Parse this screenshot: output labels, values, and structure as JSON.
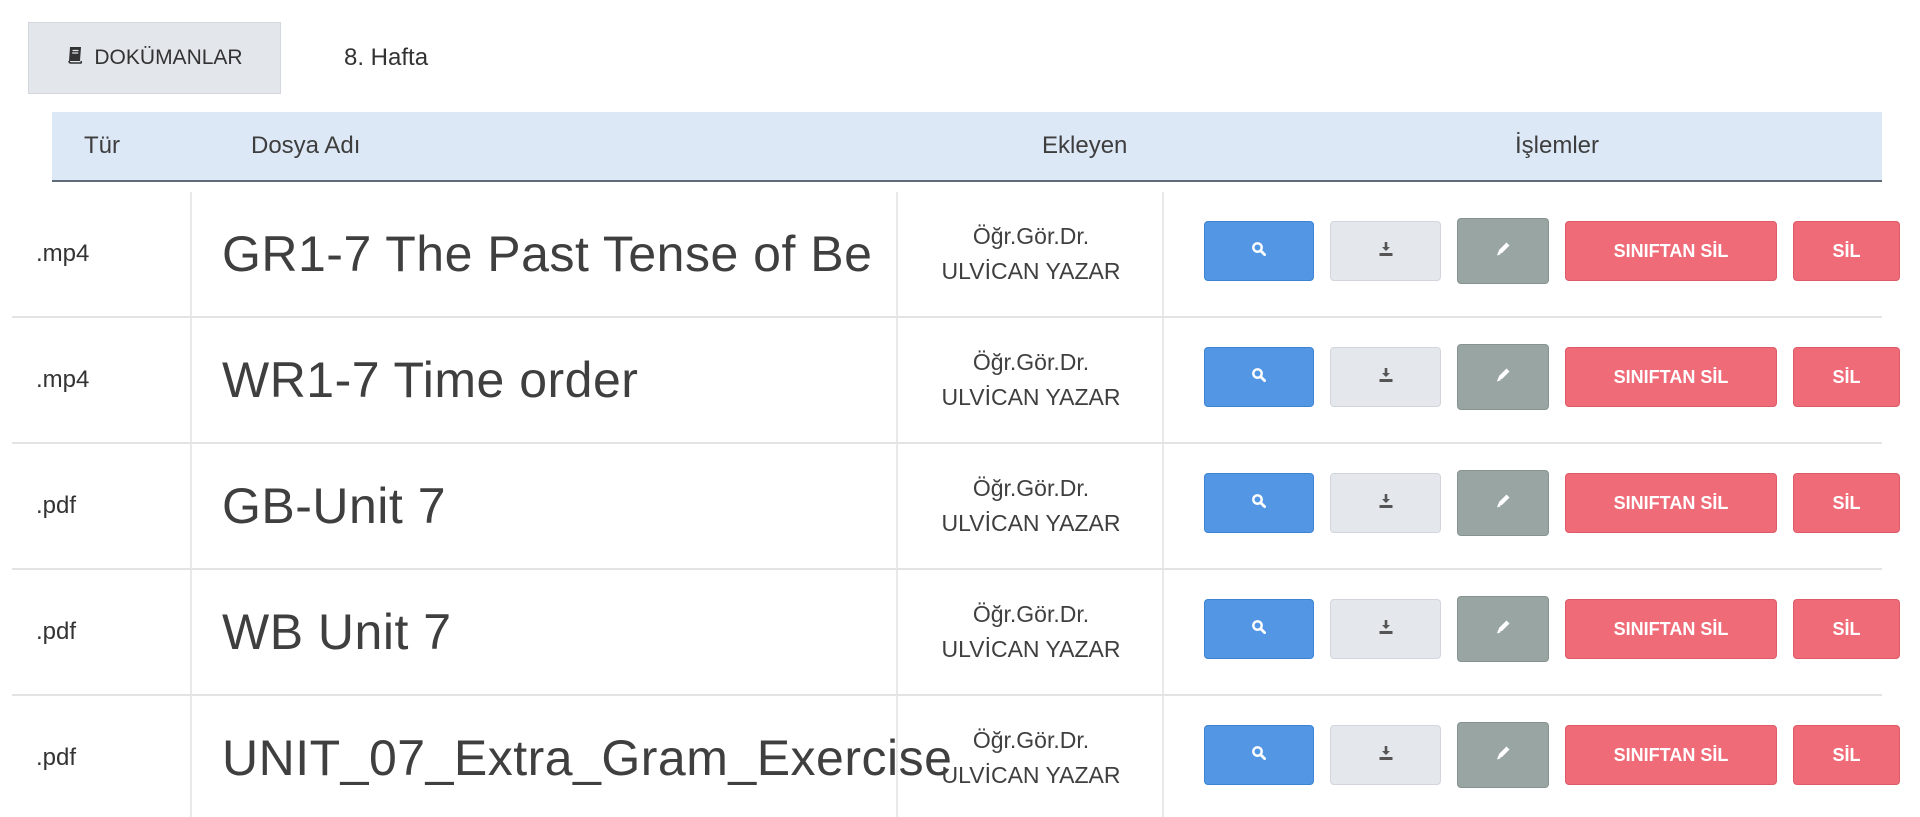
{
  "tab": {
    "label": "DOKÜMANLAR",
    "icon": "book-icon"
  },
  "week_label": "8. Hafta",
  "table": {
    "headers": {
      "type": "Tür",
      "name": "Dosya Adı",
      "added_by": "Ekleyen",
      "actions": "İşlemler"
    },
    "rows": [
      {
        "type": ".mp4",
        "name": "GR1-7 The Past Tense of Be",
        "added_by_title": "Öğr.Gör.Dr.",
        "added_by_name": "ULVİCAN YAZAR"
      },
      {
        "type": ".mp4",
        "name": "WR1-7 Time order",
        "added_by_title": "Öğr.Gör.Dr.",
        "added_by_name": "ULVİCAN YAZAR"
      },
      {
        "type": ".pdf",
        "name": "GB-Unit 7",
        "added_by_title": "Öğr.Gör.Dr.",
        "added_by_name": "ULVİCAN YAZAR"
      },
      {
        "type": ".pdf",
        "name": "WB Unit 7",
        "added_by_title": "Öğr.Gör.Dr.",
        "added_by_name": "ULVİCAN YAZAR"
      },
      {
        "type": ".pdf",
        "name": "UNIT_07_Extra_Gram_Exercise",
        "added_by_title": "Öğr.Gör.Dr.",
        "added_by_name": "ULVİCAN YAZAR"
      }
    ]
  },
  "actions": {
    "view_icon": "search-icon",
    "download_icon": "download-icon",
    "edit_icon": "pencil-icon",
    "remove_from_class_label": "SINIFTAN SİL",
    "delete_label": "SİL"
  },
  "colors": {
    "header_bg": "#dde8f6",
    "view_button": "#5296e4",
    "download_button": "#e4e7ec",
    "edit_button": "#98a5a3",
    "danger_button": "#f06b78"
  }
}
